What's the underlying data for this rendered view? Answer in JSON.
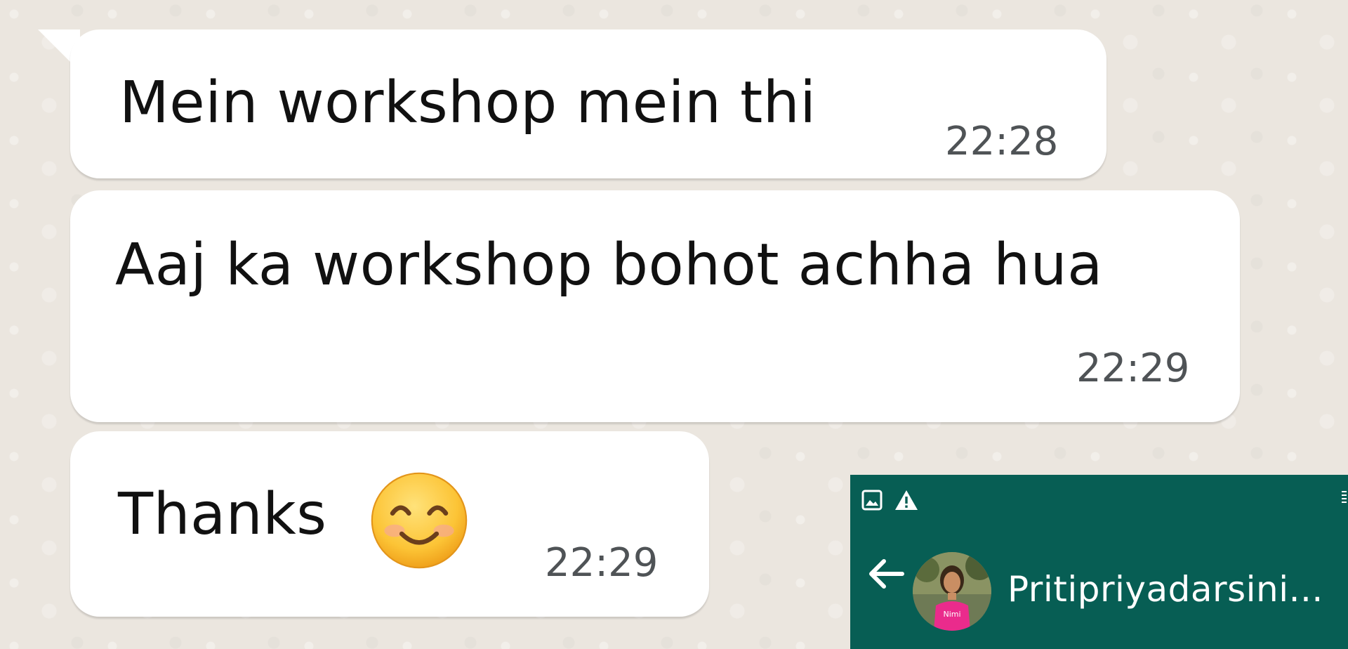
{
  "messages": [
    {
      "text": "Mein workshop mein thi",
      "time": "22:28"
    },
    {
      "text": "Aaj ka workshop bohot achha hua",
      "time": "22:29"
    },
    {
      "text": "Thanks",
      "time": "22:29",
      "emoji": "smiling-face-emoji"
    }
  ],
  "header": {
    "contact_name": "Pritipriyadarsini...",
    "avatar_shirt_text": "Nimi",
    "status_icons": [
      "gallery-icon",
      "warning-icon"
    ],
    "back_icon": "back-arrow-icon",
    "background_color": "#075e54"
  },
  "colors": {
    "chat_background": "#ece5dd",
    "bubble": "#ffffff",
    "timestamp": "#4f5356"
  }
}
